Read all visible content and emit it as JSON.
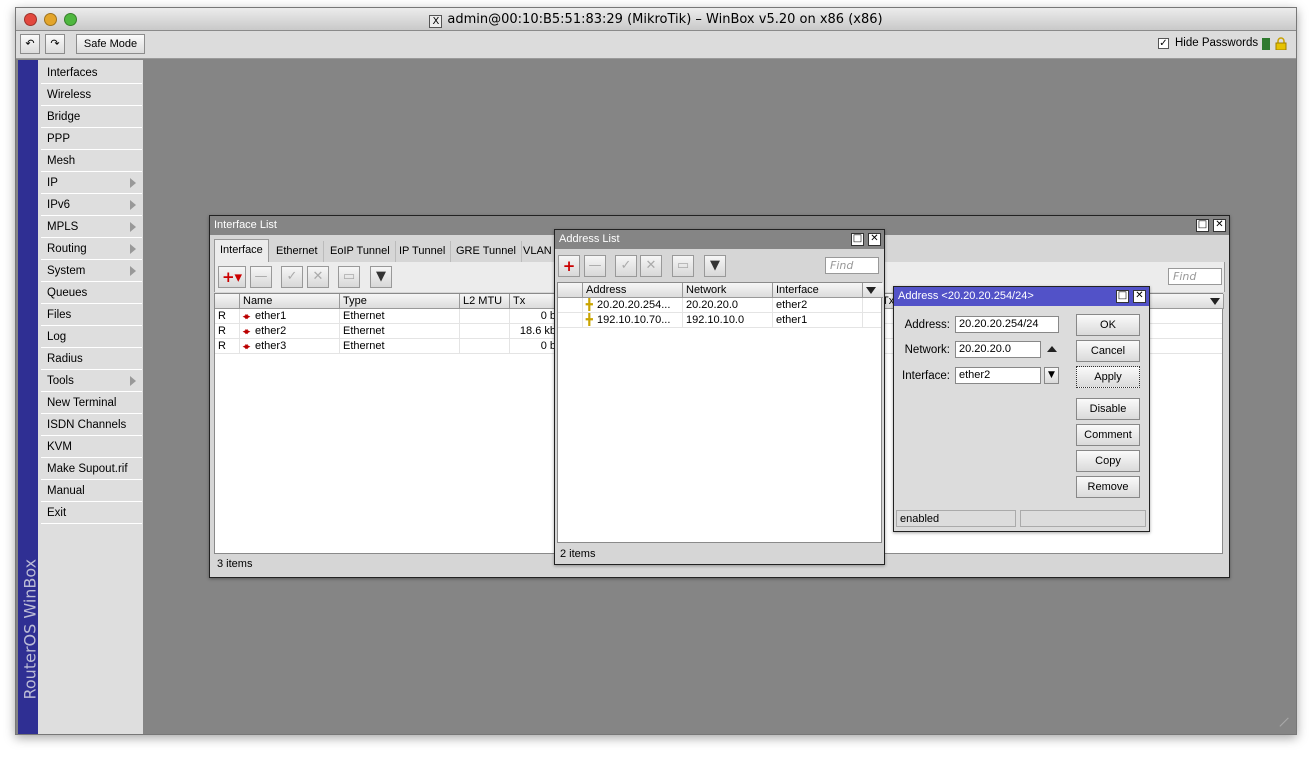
{
  "titlebar": {
    "x_label": "X",
    "title": "admin@00:10:B5:51:83:29 (MikroTik) – WinBox v5.20 on x86 (x86)"
  },
  "toolbar": {
    "undo": "↶",
    "redo": "↷",
    "safe_mode": "Safe Mode",
    "hide_passwords": "Hide Passwords"
  },
  "brand": "RouterOS WinBox",
  "menu": [
    {
      "label": "Interfaces"
    },
    {
      "label": "Wireless"
    },
    {
      "label": "Bridge"
    },
    {
      "label": "PPP"
    },
    {
      "label": "Mesh"
    },
    {
      "label": "IP"
    },
    {
      "label": "IPv6"
    },
    {
      "label": "MPLS"
    },
    {
      "label": "Routing"
    },
    {
      "label": "System"
    },
    {
      "label": "Queues"
    },
    {
      "label": "Files"
    },
    {
      "label": "Log"
    },
    {
      "label": "Radius"
    },
    {
      "label": "Tools"
    },
    {
      "label": "New Terminal"
    },
    {
      "label": "ISDN Channels"
    },
    {
      "label": "KVM"
    },
    {
      "label": "Make Supout.rif"
    },
    {
      "label": "Manual"
    },
    {
      "label": "Exit"
    }
  ],
  "iface": {
    "title": "Interface List",
    "tabs": [
      "Interface",
      "Ethernet",
      "EoIP Tunnel",
      "IP Tunnel",
      "GRE Tunnel",
      "VLAN"
    ],
    "find": "Find",
    "headers": {
      "name": "Name",
      "type": "Type",
      "l2mtu": "L2 MTU",
      "tx": "Tx",
      "tx2": "Tx"
    },
    "rows": [
      {
        "flag": "R",
        "name": "ether1",
        "type": "Ethernet",
        "tx": "0 b"
      },
      {
        "flag": "R",
        "name": "ether2",
        "type": "Ethernet",
        "tx": "18.6 kb"
      },
      {
        "flag": "R",
        "name": "ether3",
        "type": "Ethernet",
        "tx": "0 b"
      }
    ],
    "status": "3 items"
  },
  "addrlist": {
    "title": "Address List",
    "find": "Find",
    "headers": {
      "address": "Address",
      "network": "Network",
      "interface": "Interface"
    },
    "rows": [
      {
        "address": "20.20.20.254...",
        "network": "20.20.20.0",
        "interface": "ether2"
      },
      {
        "address": "192.10.10.70...",
        "network": "192.10.10.0",
        "interface": "ether1"
      }
    ],
    "status": "2 items"
  },
  "addrdlg": {
    "title": "Address <20.20.20.254/24>",
    "address_label": "Address:",
    "address": "20.20.20.254/24",
    "network_label": "Network:",
    "network": "20.20.20.0",
    "interface_label": "Interface:",
    "interface": "ether2",
    "ok": "OK",
    "cancel": "Cancel",
    "apply": "Apply",
    "disable": "Disable",
    "comment": "Comment",
    "copy": "Copy",
    "remove": "Remove",
    "status": "enabled"
  }
}
